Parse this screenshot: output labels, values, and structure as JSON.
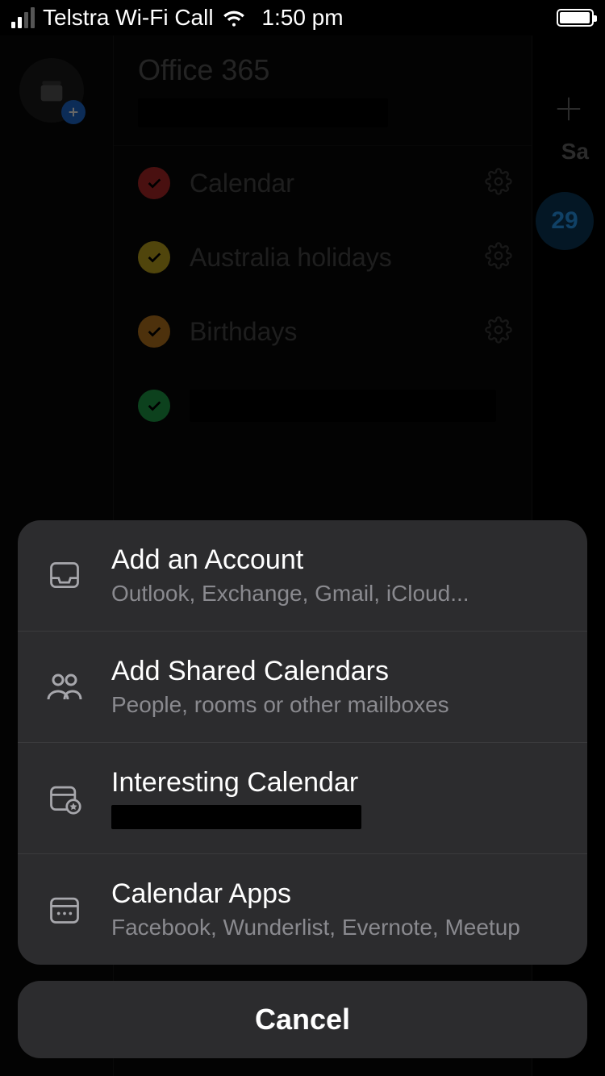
{
  "status": {
    "carrier": "Telstra Wi-Fi Call",
    "time": "1:50 pm"
  },
  "background": {
    "day_abbrev": "Sa",
    "day_number": "29"
  },
  "sidebar": {
    "account_title": "Office 365",
    "calendars": [
      {
        "label": "Calendar",
        "color": "#b62a2a"
      },
      {
        "label": "Australia holidays",
        "color": "#c8ad1e"
      },
      {
        "label": "Birthdays",
        "color": "#c07a1e"
      },
      {
        "label": "",
        "color": "#1fa24a",
        "redacted": true
      }
    ]
  },
  "sheet": {
    "items": [
      {
        "icon": "inbox",
        "title": "Add an Account",
        "subtitle": "Outlook, Exchange, Gmail, iCloud..."
      },
      {
        "icon": "people",
        "title": "Add Shared Calendars",
        "subtitle": "People, rooms or other mailboxes"
      },
      {
        "icon": "cal-star",
        "title": "Interesting Calendar",
        "subtitle": "",
        "redacted": true
      },
      {
        "icon": "cal-apps",
        "title": "Calendar Apps",
        "subtitle": "Facebook, Wunderlist, Evernote, Meetup"
      }
    ],
    "cancel_label": "Cancel"
  }
}
